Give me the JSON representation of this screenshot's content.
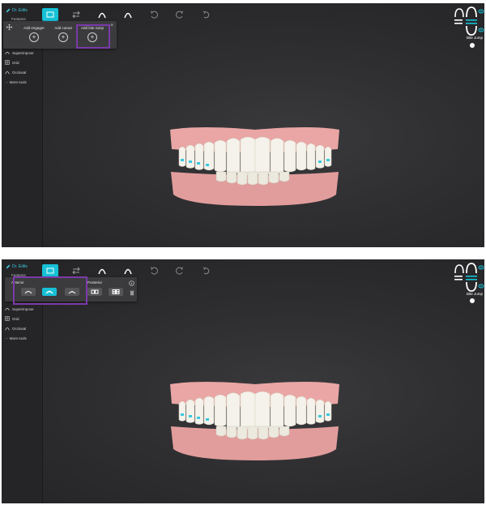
{
  "top": {
    "sidebar": {
      "title": "Dr. Edits",
      "subtitle": "Features",
      "items": [
        {
          "icon": "superimpose-icon",
          "label": "Superimpose"
        },
        {
          "icon": "grid-icon",
          "label": "Grid"
        },
        {
          "icon": "occlusal-icon",
          "label": "Occlusal"
        },
        {
          "icon": "more-tools-icon",
          "label": "··· More tools"
        }
      ]
    },
    "panel": {
      "columns": [
        "Add engager",
        "Add cutout",
        "Add bite ramp"
      ],
      "close_glyph": "×",
      "plus_glyph": "+"
    },
    "bite_jump_label": "Bite Jump"
  },
  "bottom": {
    "sidebar": {
      "title": "Dr. Edits",
      "subtitle": "Features",
      "items": [
        {
          "icon": "superimpose-icon",
          "label": "Superimpose"
        },
        {
          "icon": "grid-icon",
          "label": "Grid"
        },
        {
          "icon": "occlusal-icon",
          "label": "Occlusal"
        },
        {
          "icon": "more-tools-icon",
          "label": "··· More tools"
        }
      ]
    },
    "panel": {
      "anterior_label": "Anterior",
      "posterior_label": "Posterior",
      "selected_anterior": 1
    },
    "bite_jump_label": "Bite Jump"
  },
  "colors": {
    "accent": "#16c1d6",
    "highlight": "#7b3aa8",
    "background": "#2c2c2e",
    "gum": "#e9a6a4",
    "tooth": "#f4f2ea"
  }
}
